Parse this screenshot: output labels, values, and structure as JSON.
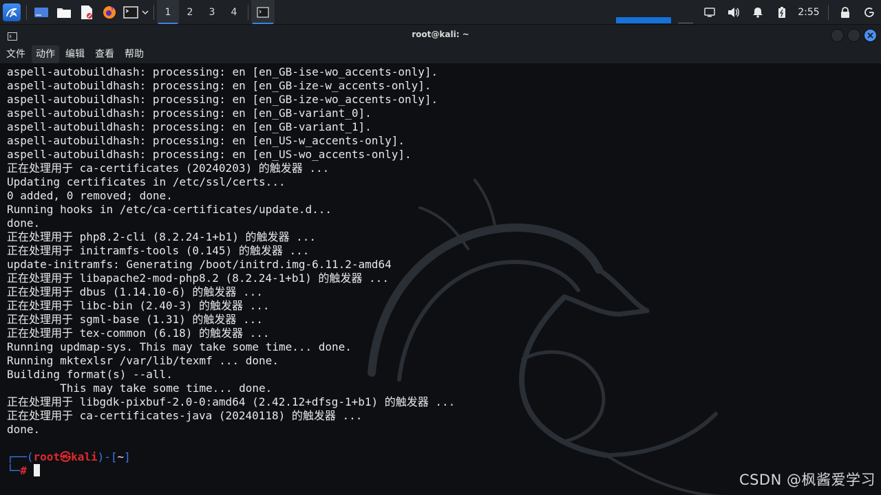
{
  "taskbar": {
    "workspaces": [
      "1",
      "2",
      "3",
      "4"
    ],
    "active_workspace": "1",
    "clock": "2:55",
    "launchers": [
      "desktop-icon",
      "file-manager-icon",
      "text-editor-icon",
      "firefox-icon",
      "terminal-icon"
    ]
  },
  "window": {
    "title": "root@kali: ~",
    "menu": [
      "文件",
      "动作",
      "编辑",
      "查看",
      "帮助"
    ]
  },
  "terminal": {
    "lines": [
      "aspell-autobuildhash: processing: en [en_GB-ise-wo_accents-only].",
      "aspell-autobuildhash: processing: en [en_GB-ize-w_accents-only].",
      "aspell-autobuildhash: processing: en [en_GB-ize-wo_accents-only].",
      "aspell-autobuildhash: processing: en [en_GB-variant_0].",
      "aspell-autobuildhash: processing: en [en_GB-variant_1].",
      "aspell-autobuildhash: processing: en [en_US-w_accents-only].",
      "aspell-autobuildhash: processing: en [en_US-wo_accents-only].",
      "正在处理用于 ca-certificates (20240203) 的触发器 ...",
      "Updating certificates in /etc/ssl/certs...",
      "0 added, 0 removed; done.",
      "Running hooks in /etc/ca-certificates/update.d...",
      "done.",
      "正在处理用于 php8.2-cli (8.2.24-1+b1) 的触发器 ...",
      "正在处理用于 initramfs-tools (0.145) 的触发器 ...",
      "update-initramfs: Generating /boot/initrd.img-6.11.2-amd64",
      "正在处理用于 libapache2-mod-php8.2 (8.2.24-1+b1) 的触发器 ...",
      "正在处理用于 dbus (1.14.10-6) 的触发器 ...",
      "正在处理用于 libc-bin (2.40-3) 的触发器 ...",
      "正在处理用于 sgml-base (1.31) 的触发器 ...",
      "正在处理用于 tex-common (6.18) 的触发器 ...",
      "Running updmap-sys. This may take some time... done.",
      "Running mktexlsr /var/lib/texmf ... done.",
      "Building format(s) --all.",
      "        This may take some time... done.",
      "正在处理用于 libgdk-pixbuf-2.0-0:amd64 (2.42.12+dfsg-1+b1) 的触发器 ...",
      "正在处理用于 ca-certificates-java (20240118) 的触发器 ...",
      "done."
    ],
    "prompt": {
      "user": "root",
      "at": "㉿",
      "host": "kali",
      "dir": "~",
      "symbol": "#"
    }
  },
  "watermark": "CSDN @枫酱爱学习",
  "colors": {
    "prompt_frame": "#3b78e7",
    "prompt_user": "#e0292b",
    "accent": "#3c84e6"
  }
}
